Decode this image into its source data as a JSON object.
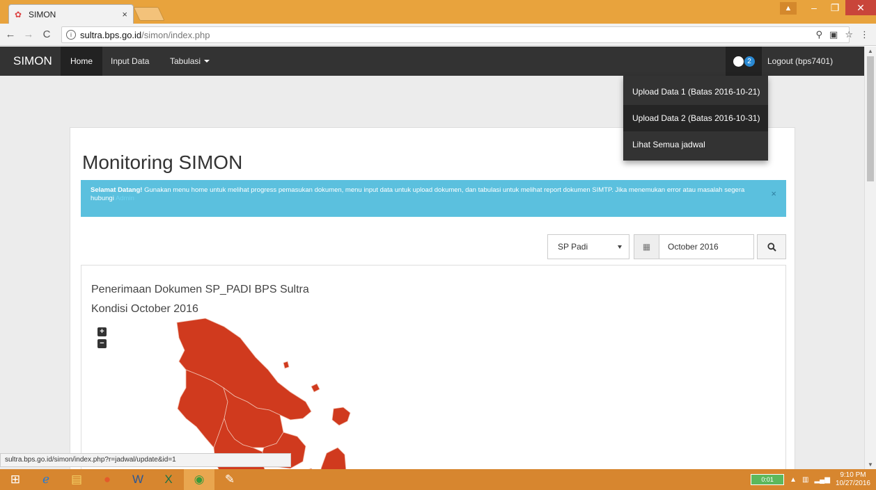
{
  "browser": {
    "tab_title": "SIMON",
    "tab_close": "×",
    "url_host": "sultra.bps.go.id",
    "url_path": "/simon/index.php",
    "status_url": "sultra.bps.go.id/simon/index.php?r=jadwal/update&id=1"
  },
  "navbar": {
    "brand": "SIMON",
    "home": "Home",
    "input_data": "Input Data",
    "tabulasi": "Tabulasi",
    "notification_count": "2",
    "logout": "Logout (bps7401)"
  },
  "dropdown": {
    "items": [
      "Upload Data 1 (Batas 2016-10-21)",
      "Upload Data 2 (Batas 2016-10-31)",
      "Lihat Semua jadwal"
    ]
  },
  "page": {
    "title": "Monitoring SIMON",
    "alert": {
      "strong": "Selamat Datang!",
      "text": " Gunakan menu home untuk melihat progress pemasukan dokumen, menu input data untuk upload dokumen, dan tabulasi untuk melihat report dokumen SIMTP. Jika menemukan error atau masalah segera hubungi ",
      "link": "Admin",
      "close": "×"
    },
    "filter": {
      "select_value": "SP Padi",
      "date_value": "October 2016"
    },
    "map": {
      "title": "Penerimaan Dokumen SP_PADI BPS Sultra",
      "subtitle": "Kondisi October 2016",
      "zoom_in": "+",
      "zoom_out": "−",
      "fill_color": "#d03a1e"
    }
  },
  "taskbar": {
    "battery": "0:01",
    "time": "9:10 PM",
    "date": "10/27/2016"
  }
}
